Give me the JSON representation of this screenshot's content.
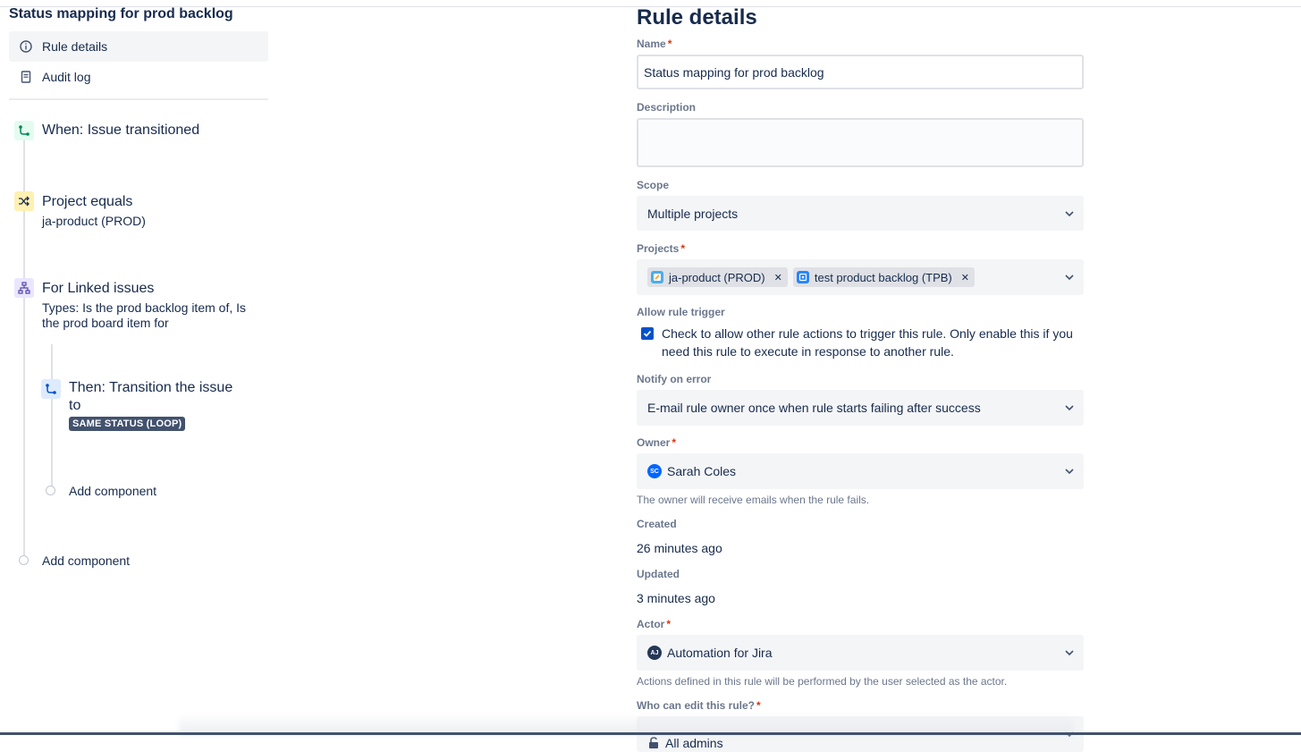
{
  "rule": {
    "title": "Status mapping for prod backlog"
  },
  "nav": {
    "items": [
      {
        "label": "Rule details",
        "icon": "info-icon",
        "active": true
      },
      {
        "label": "Audit log",
        "icon": "document-icon",
        "active": false
      }
    ]
  },
  "flow": {
    "trigger": {
      "title": "When: Issue transitioned",
      "icon": "transition-icon",
      "color": "#e3fcef"
    },
    "condition": {
      "title": "Project equals",
      "subtitle": "ja-product (PROD)",
      "icon": "shuffle-icon",
      "color": "#fff0b3"
    },
    "branch": {
      "title": "For Linked issues",
      "subtitle": "Types: Is the prod backlog item of, Is the prod board item for",
      "icon": "hierarchy-icon",
      "color": "#eae6ff"
    },
    "action": {
      "title_line1": "Then: Transition the issue",
      "title_line2": "to",
      "lozenge": "SAME STATUS (LOOP)",
      "icon": "transition-icon",
      "color": "#deebff"
    },
    "add_inner": "Add component",
    "add_outer": "Add component"
  },
  "form": {
    "heading": "Rule details",
    "name": {
      "label": "Name",
      "value": "Status mapping for prod backlog"
    },
    "description": {
      "label": "Description",
      "value": ""
    },
    "scope": {
      "label": "Scope",
      "value": "Multiple projects"
    },
    "projects": {
      "label": "Projects",
      "tags": [
        {
          "label": "ja-product (PROD)",
          "icon": "project-icon",
          "color": "#4bade8"
        },
        {
          "label": "test product backlog (TPB)",
          "icon": "project-icon",
          "color": "#2684ff"
        }
      ]
    },
    "allow_trigger": {
      "label": "Allow rule trigger",
      "text": "Check to allow other rule actions to trigger this rule. Only enable this if you need this rule to execute in response to another rule.",
      "checked": true
    },
    "notify": {
      "label": "Notify on error",
      "value": "E-mail rule owner once when rule starts failing after success"
    },
    "owner": {
      "label": "Owner",
      "value": "Sarah Coles",
      "initials": "SC",
      "avatar_color": "#0065ff",
      "helper": "The owner will receive emails when the rule fails."
    },
    "created": {
      "label": "Created",
      "value": "26 minutes ago"
    },
    "updated": {
      "label": "Updated",
      "value": "3 minutes ago"
    },
    "actor": {
      "label": "Actor",
      "value": "Automation for Jira",
      "initials": "AJ",
      "avatar_color": "#253858",
      "helper": "Actions defined in this rule will be performed by the user selected as the actor."
    },
    "editors": {
      "label": "Who can edit this rule?",
      "value": "All admins",
      "icon": "unlock-icon"
    }
  }
}
